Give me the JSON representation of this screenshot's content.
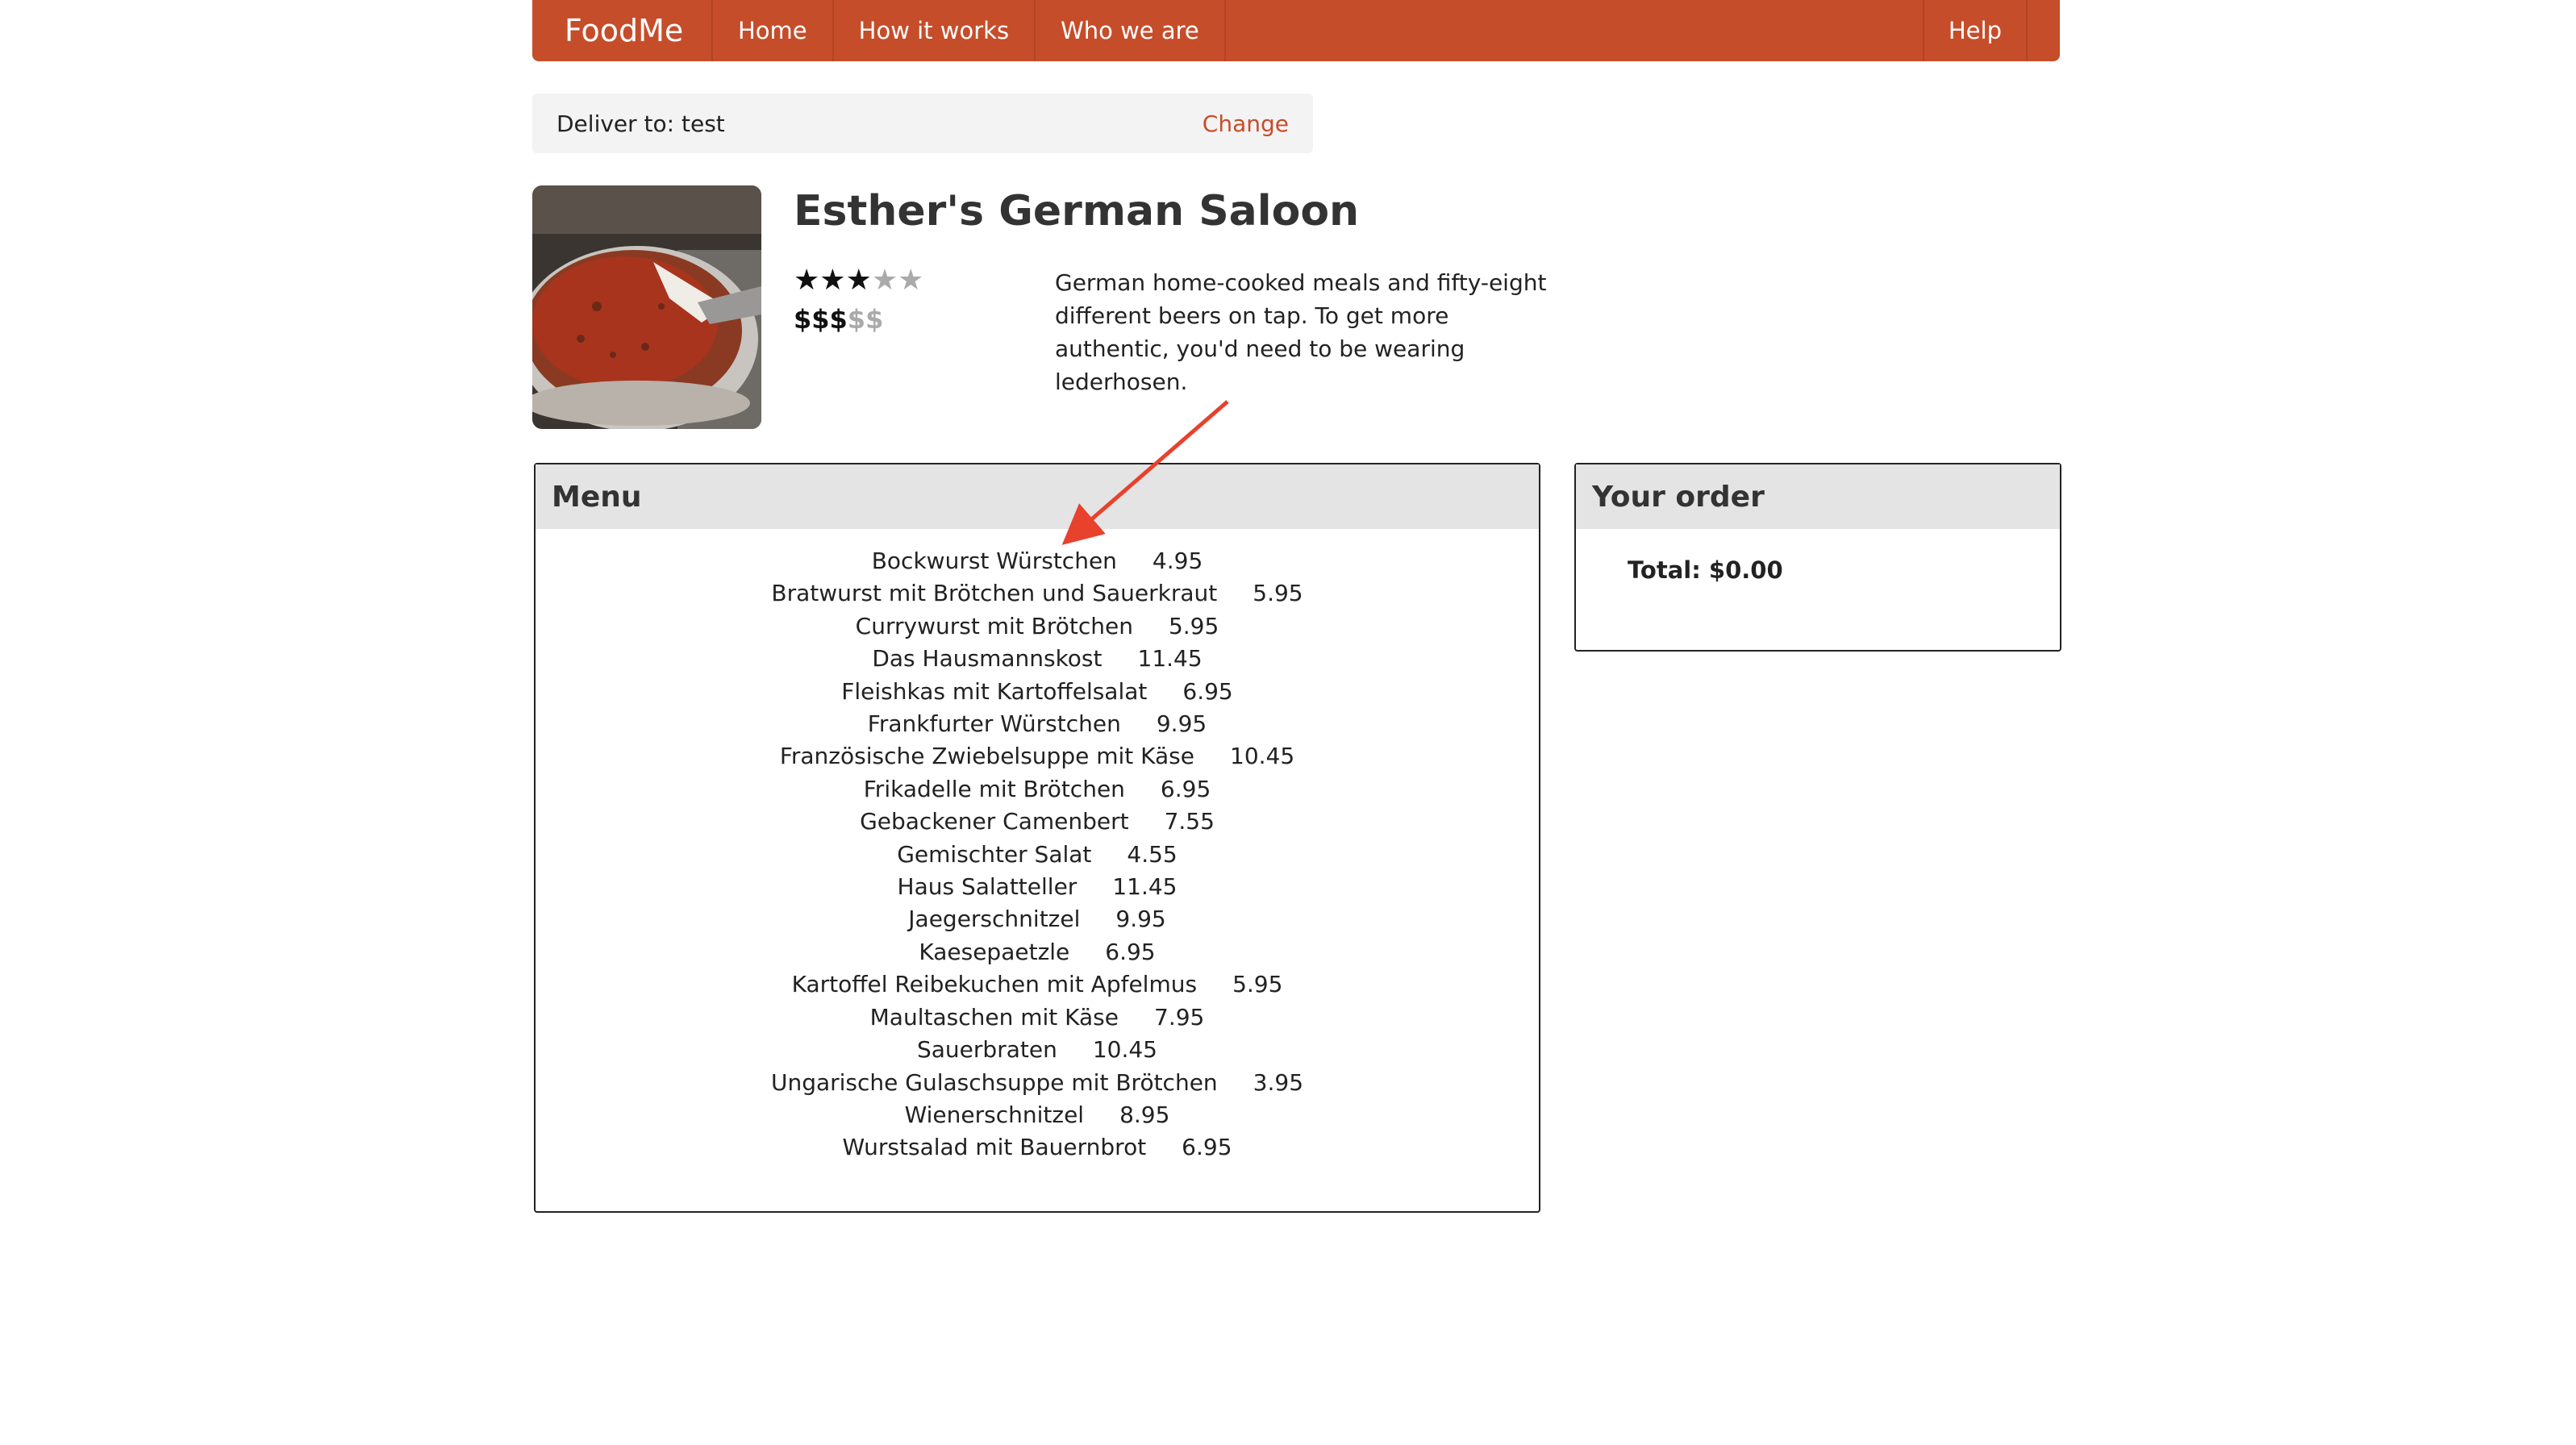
{
  "navbar": {
    "brand": "FoodMe",
    "items": [
      "Home",
      "How it works",
      "Who we are"
    ],
    "help": "Help"
  },
  "deliver": {
    "label": "Deliver to: test",
    "change": "Change"
  },
  "restaurant": {
    "name": "Esther's German Saloon",
    "rating": 3,
    "rating_max": 5,
    "price": 3,
    "price_max": 5,
    "description": "German home-cooked meals and fifty-eight different beers on tap. To get more authentic, you'd need to be wearing lederhosen."
  },
  "menu": {
    "title": "Menu",
    "items": [
      {
        "name": "Bockwurst Würstchen",
        "price": "4.95"
      },
      {
        "name": "Bratwurst mit Brötchen und Sauerkraut",
        "price": "5.95"
      },
      {
        "name": "Currywurst mit Brötchen",
        "price": "5.95"
      },
      {
        "name": "Das Hausmannskost",
        "price": "11.45"
      },
      {
        "name": "Fleishkas mit Kartoffelsalat",
        "price": "6.95"
      },
      {
        "name": "Frankfurter Würstchen",
        "price": "9.95"
      },
      {
        "name": "Französische Zwiebelsuppe mit Käse",
        "price": "10.45"
      },
      {
        "name": "Frikadelle mit Brötchen",
        "price": "6.95"
      },
      {
        "name": "Gebackener Camenbert",
        "price": "7.55"
      },
      {
        "name": "Gemischter Salat",
        "price": "4.55"
      },
      {
        "name": "Haus Salatteller",
        "price": "11.45"
      },
      {
        "name": "Jaegerschnitzel",
        "price": "9.95"
      },
      {
        "name": "Kaesepaetzle",
        "price": "6.95"
      },
      {
        "name": "Kartoffel Reibekuchen mit Apfelmus",
        "price": "5.95"
      },
      {
        "name": "Maultaschen mit Käse",
        "price": "7.95"
      },
      {
        "name": "Sauerbraten",
        "price": "10.45"
      },
      {
        "name": "Ungarische Gulaschsuppe mit Brötchen",
        "price": "3.95"
      },
      {
        "name": "Wienerschnitzel",
        "price": "8.95"
      },
      {
        "name": "Wurstsalad mit Bauernbrot",
        "price": "6.95"
      }
    ]
  },
  "order": {
    "title": "Your order",
    "total": "Total: $0.00"
  },
  "colors": {
    "brand": "#c64d2a",
    "annotation": "#e8412c"
  }
}
